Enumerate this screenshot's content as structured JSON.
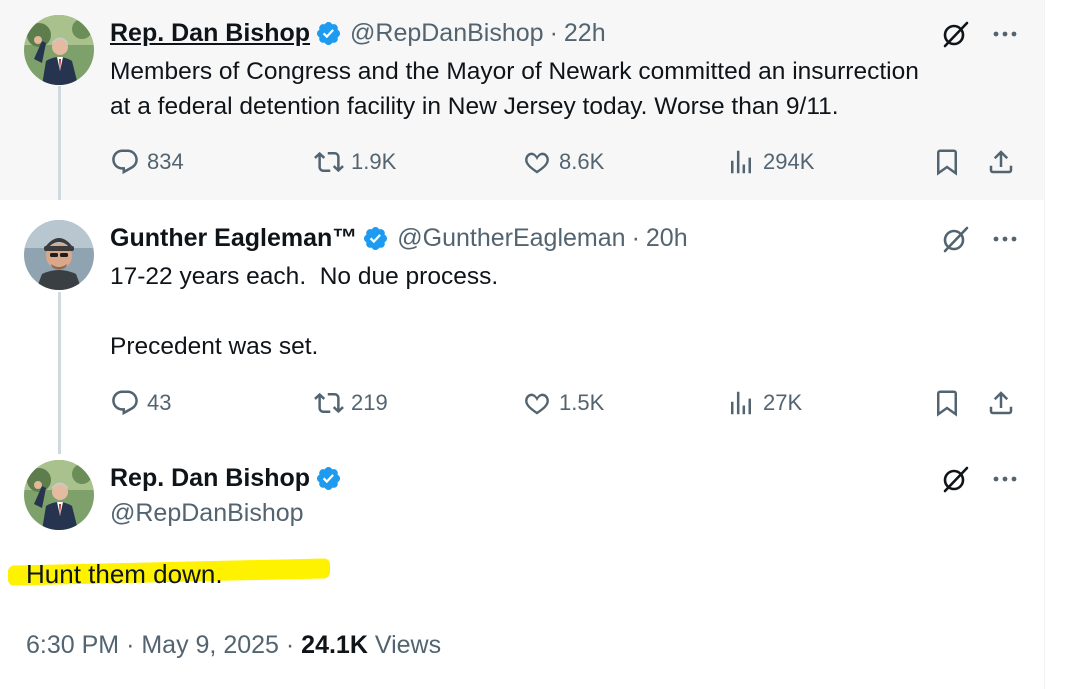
{
  "posts": [
    {
      "name": "Rep. Dan Bishop",
      "handle": "@RepDanBishop",
      "time": "22h",
      "text_lines": [
        "Members of Congress and the Mayor of Newark committed an insurrection",
        "at a federal detention facility in New Jersey today. Worse than 9/11."
      ],
      "replies": "834",
      "reposts": "1.9K",
      "likes": "8.6K",
      "views": "294K"
    },
    {
      "name": "Gunther Eagleman™",
      "handle": "@GuntherEagleman",
      "time": "20h",
      "text_lines": [
        "17-22 years each.  No due process.",
        "",
        "Precedent was set."
      ],
      "replies": "43",
      "reposts": "219",
      "likes": "1.5K",
      "views": "27K"
    }
  ],
  "main_post": {
    "name": "Rep. Dan Bishop",
    "handle": "@RepDanBishop",
    "text": "Hunt them down.",
    "time": "6:30 PM",
    "date": "May 9, 2025",
    "views_count": "24.1K",
    "views_label": "Views"
  },
  "separator": "·",
  "icons": {
    "verified": "verified-badge-icon",
    "grok": "grok-icon",
    "more": "more-options-icon",
    "reply": "reply-icon",
    "repost": "repost-icon",
    "like": "like-icon",
    "views": "views-icon",
    "bookmark": "bookmark-icon",
    "share": "share-icon"
  },
  "colors": {
    "verified": "#1d9bf0",
    "secondary_text": "#536471",
    "highlight": "#fff200",
    "first_post_bg": "#f7f7f7",
    "thread_line": "#cfd9de"
  }
}
